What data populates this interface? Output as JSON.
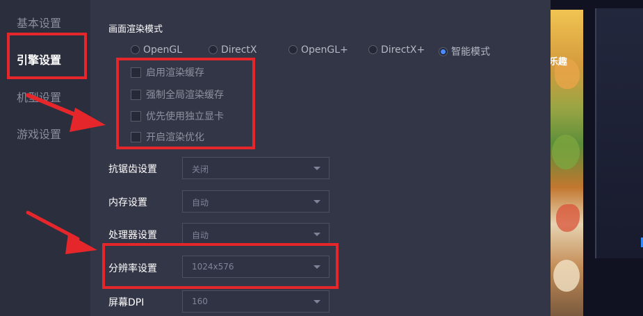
{
  "sidebar": {
    "items": [
      {
        "label": "基本设置",
        "active": false
      },
      {
        "label": "引擎设置",
        "active": true
      },
      {
        "label": "机型设置",
        "active": false
      },
      {
        "label": "游戏设置",
        "active": false
      }
    ]
  },
  "render": {
    "title": "画面渲染模式",
    "options": [
      {
        "label": "OpenGL",
        "selected": false
      },
      {
        "label": "DirectX",
        "selected": false
      },
      {
        "label": "OpenGL+",
        "selected": false
      },
      {
        "label": "DirectX+",
        "selected": false
      },
      {
        "label": "智能模式",
        "selected": true
      }
    ],
    "checkboxes": [
      {
        "label": "启用渲染缓存",
        "checked": false
      },
      {
        "label": "强制全局渲染缓存",
        "checked": false
      },
      {
        "label": "优先使用独立显卡",
        "checked": false
      },
      {
        "label": "开启渲染优化",
        "checked": false
      }
    ]
  },
  "settings": [
    {
      "label": "抗锯齿设置",
      "value": "关闭"
    },
    {
      "label": "内存设置",
      "value": "自动"
    },
    {
      "label": "处理器设置",
      "value": "自动"
    },
    {
      "label": "分辨率设置",
      "value": "1024x576"
    },
    {
      "label": "屏幕DPI",
      "value": "160"
    }
  ],
  "game": {
    "banner_text": "乐趣"
  },
  "colors": {
    "accent": "#4a8cff",
    "highlight_red": "#e5262a",
    "sidebar_bg": "#2b2e3d",
    "panel_bg": "#333646"
  },
  "icons": {
    "dropdown": "chevron-down-icon",
    "annotation": "red-arrow-icon"
  }
}
